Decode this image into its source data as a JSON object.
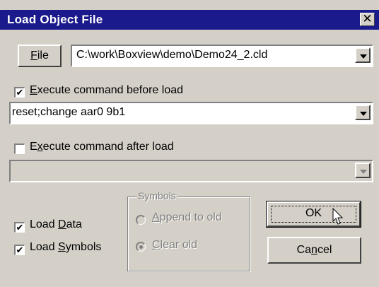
{
  "title": "Load Object File",
  "close_glyph": "✕",
  "file_button": {
    "pre": "",
    "u": "F",
    "post": "ile"
  },
  "file_path": "C:\\work\\Boxview\\demo\\Demo24_2.cld",
  "exec_before": {
    "checked": true,
    "pre": "",
    "u": "E",
    "post": "xecute command before load"
  },
  "before_command": "reset;change aar0 9b1",
  "exec_after": {
    "checked": false,
    "pre": "E",
    "u": "x",
    "post": "ecute command after load"
  },
  "after_command": "",
  "load_data": {
    "checked": true,
    "pre": "Load ",
    "u": "D",
    "post": "ata"
  },
  "load_symbols": {
    "checked": true,
    "pre": "Load ",
    "u": "S",
    "post": "ymbols"
  },
  "symbols_group": {
    "title": "Symbols",
    "append": {
      "u": "A",
      "post": "ppend to old",
      "selected": false
    },
    "clear": {
      "u": "C",
      "post": "lear old",
      "selected": true
    }
  },
  "ok_button": "OK",
  "cancel_button": {
    "pre": "Ca",
    "u": "n",
    "post": "cel"
  },
  "check_glyph": "✔"
}
